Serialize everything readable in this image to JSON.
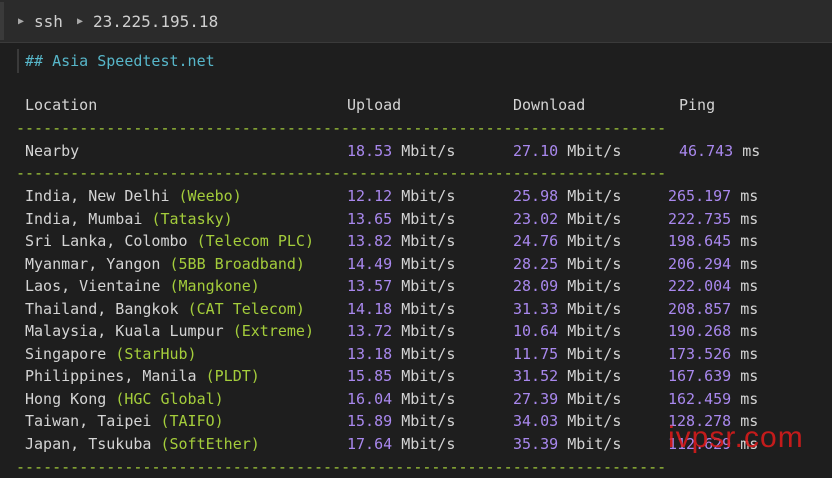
{
  "titlebar": {
    "segment1": "ssh",
    "segment2": "23.225.195.18"
  },
  "heading": "## Asia Speedtest.net",
  "columns": {
    "location": "Location",
    "upload": "Upload",
    "download": "Download",
    "ping": "Ping"
  },
  "separator": "------------------------------------------------------------------------",
  "nearby": {
    "location": "Nearby",
    "upload": "18.53",
    "download": "27.10",
    "ping": "46.743",
    "unit_speed": "Mbit/s",
    "unit_ping": "ms"
  },
  "rows": [
    {
      "location": "India, New Delhi ",
      "provider": "(Weebo)",
      "upload": "12.12",
      "download": "25.98",
      "ping": "265.197"
    },
    {
      "location": "India, Mumbai ",
      "provider": "(Tatasky)",
      "upload": "13.65",
      "download": "23.02",
      "ping": "222.735"
    },
    {
      "location": "Sri Lanka, Colombo ",
      "provider": "(Telecom PLC)",
      "upload": "13.82",
      "download": "24.76",
      "ping": "198.645"
    },
    {
      "location": "Myanmar, Yangon ",
      "provider": "(5BB Broadband)",
      "upload": "14.49",
      "download": "28.25",
      "ping": "206.294"
    },
    {
      "location": "Laos, Vientaine ",
      "provider": "(Mangkone)",
      "upload": "13.57",
      "download": "28.09",
      "ping": "222.004"
    },
    {
      "location": "Thailand, Bangkok ",
      "provider": "(CAT Telecom)",
      "upload": "14.18",
      "download": "31.33",
      "ping": "208.857"
    },
    {
      "location": "Malaysia, Kuala Lumpur ",
      "provider": "(Extreme)",
      "upload": "13.72",
      "download": "10.64",
      "ping": "190.268"
    },
    {
      "location": "Singapore ",
      "provider": "(StarHub)",
      "upload": "13.18",
      "download": "11.75",
      "ping": "173.526"
    },
    {
      "location": "Philippines, Manila ",
      "provider": "(PLDT)",
      "upload": "15.85",
      "download": "31.52",
      "ping": "167.639"
    },
    {
      "location": "Hong Kong ",
      "provider": "(HGC Global)",
      "upload": "16.04",
      "download": "27.39",
      "ping": "162.459"
    },
    {
      "location": "Taiwan, Taipei ",
      "provider": "(TAIFO)",
      "upload": "15.89",
      "download": "34.03",
      "ping": "128.278"
    },
    {
      "location": "Japan, Tsukuba ",
      "provider": "(SoftEther)",
      "upload": "17.64",
      "download": "35.39",
      "ping": "112.629"
    }
  ],
  "units": {
    "speed": "Mbit/s",
    "ping": "ms"
  },
  "watermark": "ivpsr.com"
}
